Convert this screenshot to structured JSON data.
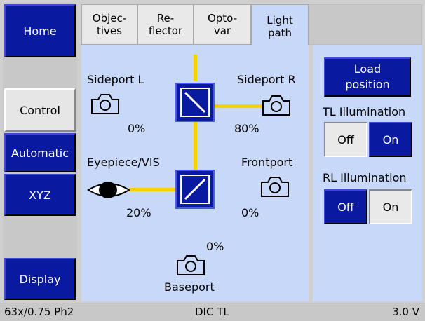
{
  "nav": {
    "home": "Home",
    "control": "Control",
    "automatic": "Automatic",
    "xyz": "XYZ",
    "display": "Display"
  },
  "tabs": {
    "objectives": [
      "Objec-",
      "tives"
    ],
    "reflector": [
      "Re-",
      "flector"
    ],
    "optovar": [
      "Opto-",
      "var"
    ],
    "lightpath": [
      "Light",
      "path"
    ]
  },
  "ports": {
    "sideport_l": {
      "label": "Sideport L",
      "value": "0%"
    },
    "sideport_r": {
      "label": "Sideport R",
      "value": "80%"
    },
    "eyepiece": {
      "label": "Eyepiece/VIS",
      "value": "20%"
    },
    "frontport": {
      "label": "Frontport",
      "value": "0%"
    },
    "baseport": {
      "label": "Baseport",
      "value": "0%"
    }
  },
  "right_panel": {
    "load_position": [
      "Load",
      "position"
    ],
    "tl_illumination": "TL Illumination",
    "tl_off": "Off",
    "tl_on": "On",
    "rl_illumination": "RL Illumination",
    "rl_off": "Off",
    "rl_on": "On"
  },
  "status": {
    "objective": "63x/0.75 Ph2",
    "method": "DIC TL",
    "voltage": "3.0 V"
  },
  "colors": {
    "button_blue": "#0a1aa0",
    "panel_blue": "#c8d8f8",
    "beam_yellow": "#f5d300"
  }
}
